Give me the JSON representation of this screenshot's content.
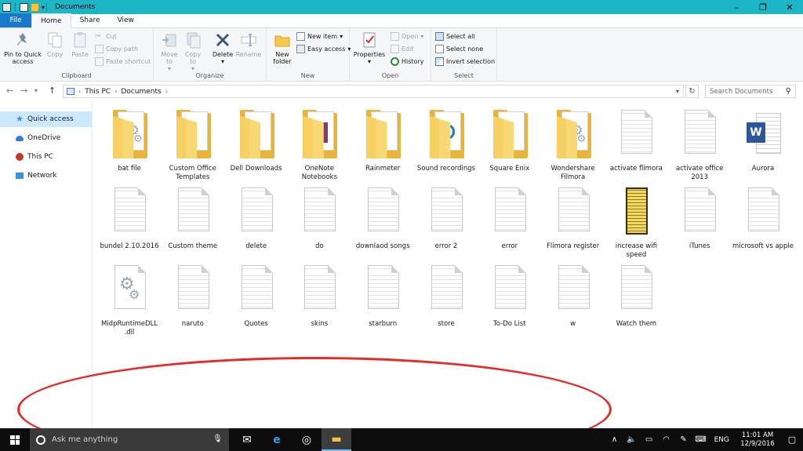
{
  "window": {
    "title": "Documents"
  },
  "tabs": [
    "File",
    "Home",
    "Share",
    "View"
  ],
  "ribbon": {
    "clipboard": {
      "label": "Clipboard",
      "pin": "Pin to Quick access",
      "copy": "Copy",
      "paste": "Paste",
      "cut": "Cut",
      "copy_path": "Copy path",
      "paste_shortcut": "Paste shortcut"
    },
    "organize": {
      "label": "Organize",
      "move_to": "Move to",
      "copy_to": "Copy to",
      "delete": "Delete",
      "rename": "Rename"
    },
    "new": {
      "label": "New",
      "new_folder": "New folder",
      "new_item": "New item",
      "easy_access": "Easy access"
    },
    "open": {
      "label": "Open",
      "properties": "Properties",
      "open": "Open",
      "edit": "Edit",
      "history": "History"
    },
    "select": {
      "label": "Select",
      "select_all": "Select all",
      "select_none": "Select none",
      "invert": "Invert selection"
    }
  },
  "address": {
    "path": [
      "This PC",
      "Documents"
    ],
    "search_placeholder": "Search Documents"
  },
  "nav": [
    {
      "label": "Quick access",
      "icon": "star-icon",
      "color": "#3a8ee6"
    },
    {
      "label": "OneDrive",
      "icon": "cloud-icon",
      "color": "#2f7fd8"
    },
    {
      "label": "This PC",
      "icon": "computer-icon",
      "color": "#c0392b"
    },
    {
      "label": "Network",
      "icon": "network-icon",
      "color": "#3a8ee6"
    }
  ],
  "files": [
    {
      "name": "bat file",
      "type": "folder-gear"
    },
    {
      "name": "Custom Office Templates",
      "type": "folder"
    },
    {
      "name": "Dell Downloads",
      "type": "folder"
    },
    {
      "name": "OneNote Notebooks",
      "type": "folder-onenote"
    },
    {
      "name": "Rainmeter",
      "type": "folder"
    },
    {
      "name": "Sound recordings",
      "type": "folder-groove"
    },
    {
      "name": "Square Enix",
      "type": "folder"
    },
    {
      "name": "Wondershare Filmora",
      "type": "folder-gear"
    },
    {
      "name": "activate flimora",
      "type": "doc"
    },
    {
      "name": "activate office 2013",
      "type": "doc"
    },
    {
      "name": "Aurora",
      "type": "word"
    },
    {
      "name": "bundel 2.10.2016",
      "type": "doc"
    },
    {
      "name": "Custom theme",
      "type": "doc"
    },
    {
      "name": "delete",
      "type": "doc"
    },
    {
      "name": "do",
      "type": "doc"
    },
    {
      "name": "downlaod songs",
      "type": "doc"
    },
    {
      "name": "error 2",
      "type": "doc"
    },
    {
      "name": "error",
      "type": "doc"
    },
    {
      "name": "Flimora register",
      "type": "doc"
    },
    {
      "name": "increase wifi speed",
      "type": "notepad"
    },
    {
      "name": "iTunes",
      "type": "doc"
    },
    {
      "name": "microsoft vs apple",
      "type": "doc"
    },
    {
      "name": "MidpRuntimeDLL .dll",
      "type": "gear-doc"
    },
    {
      "name": "naruto",
      "type": "doc"
    },
    {
      "name": "Quotes",
      "type": "doc"
    },
    {
      "name": "skins",
      "type": "doc"
    },
    {
      "name": "starburn",
      "type": "doc"
    },
    {
      "name": "store",
      "type": "doc"
    },
    {
      "name": "To-Do List",
      "type": "doc"
    },
    {
      "name": "w",
      "type": "doc"
    },
    {
      "name": "Watch them",
      "type": "doc"
    }
  ],
  "taskbar": {
    "search_placeholder": "Ask me anything",
    "language": "ENG",
    "time": "11:01 AM",
    "date": "12/9/2016"
  }
}
